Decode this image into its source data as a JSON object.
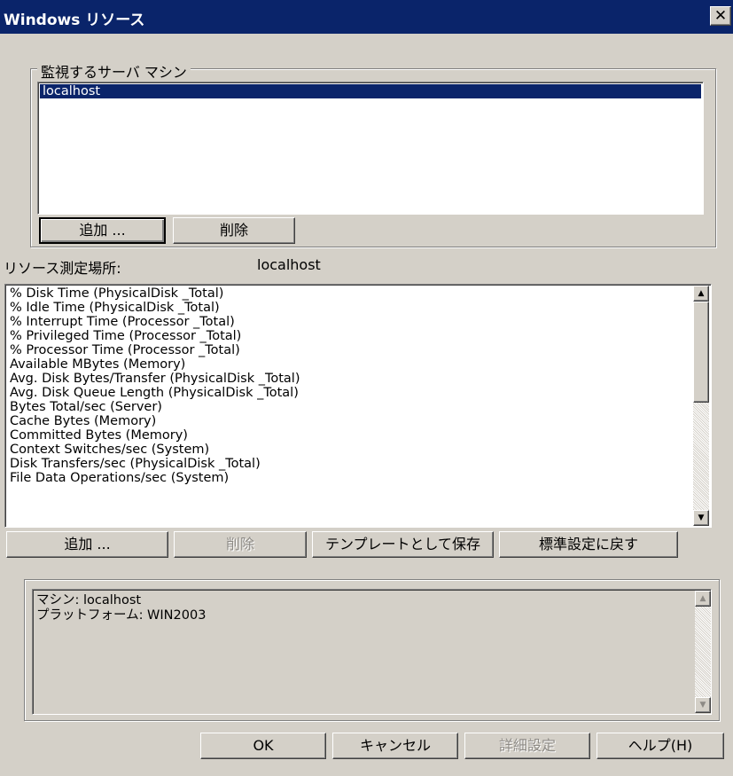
{
  "window": {
    "title": "Windows リソース",
    "close_label": "✕"
  },
  "servers": {
    "group_label": "監視するサーバ マシン",
    "items": [
      "localhost"
    ],
    "add_label": "追加 ...",
    "delete_label": "削除"
  },
  "measure": {
    "label": "リソース測定場所:",
    "value": "localhost"
  },
  "counters": {
    "items": [
      "% Disk Time (PhysicalDisk _Total)",
      "% Idle Time (PhysicalDisk _Total)",
      "% Interrupt Time (Processor _Total)",
      "% Privileged Time (Processor _Total)",
      "% Processor Time (Processor _Total)",
      "Available MBytes (Memory)",
      "Avg. Disk Bytes/Transfer (PhysicalDisk _Total)",
      "Avg. Disk Queue Length (PhysicalDisk _Total)",
      "Bytes Total/sec (Server)",
      "Cache Bytes (Memory)",
      "Committed Bytes (Memory)",
      "Context Switches/sec (System)",
      "Disk Transfers/sec (PhysicalDisk _Total)",
      "File Data Operations/sec (System)"
    ],
    "add_label": "追加 ...",
    "delete_label": "削除",
    "save_template_label": "テンプレートとして保存",
    "reset_label": "標準設定に戻す"
  },
  "info": {
    "lines": [
      "マシン: localhost",
      "プラットフォーム: WIN2003"
    ]
  },
  "footer": {
    "ok_label": "OK",
    "cancel_label": "キャンセル",
    "advanced_label": "詳細設定",
    "help_label": "ヘルプ(H)"
  }
}
